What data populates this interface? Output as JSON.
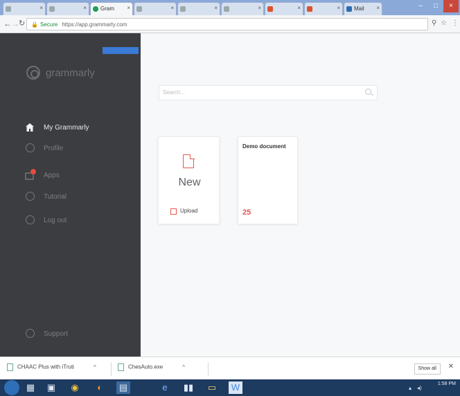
{
  "browser": {
    "tabs": [
      {
        "label": "",
        "icon": "page-icon"
      },
      {
        "label": "",
        "icon": "page-icon"
      },
      {
        "label": "Gram",
        "icon": "grammarly-icon",
        "active": true
      },
      {
        "label": "",
        "icon": "page-icon"
      },
      {
        "label": "",
        "icon": "page-icon"
      },
      {
        "label": "",
        "icon": "page-icon"
      },
      {
        "label": "",
        "icon": "office-icon"
      },
      {
        "label": "",
        "icon": "office-icon"
      },
      {
        "label": "Mail",
        "icon": "mail-icon"
      }
    ],
    "address": {
      "secure_label": "Secure",
      "url": "https://app.grammarly.com"
    }
  },
  "sidebar": {
    "beta_label": "",
    "brand": "grammarly",
    "items": [
      {
        "label": "My Grammarly",
        "icon": "home-icon",
        "active": true
      },
      {
        "label": "Profile",
        "icon": "profile-icon"
      },
      {
        "label": "Apps",
        "icon": "apps-icon",
        "badge": true
      },
      {
        "label": "Tutorial",
        "icon": "info-icon"
      },
      {
        "label": "Log out",
        "icon": "logout-icon"
      }
    ],
    "support_label": "Support"
  },
  "main": {
    "search": {
      "placeholder": "Search..."
    },
    "new_card": {
      "label": "New",
      "upload_label": "Upload"
    },
    "documents": [
      {
        "title": "Demo document",
        "excerpt": "",
        "count": "25"
      }
    ]
  },
  "downloads": {
    "items": [
      {
        "label": "CHAAC Plus with iTruti"
      },
      {
        "label": "ChesAuto.exe"
      }
    ],
    "show_all": "Show all"
  },
  "taskbar": {
    "time": "1:58 PM"
  },
  "colors": {
    "sidebar_bg": "#3b3d40",
    "accent_red": "#e2574c",
    "beta_blue": "#3a7bd5",
    "taskbar_bg": "#1d3a5f"
  }
}
